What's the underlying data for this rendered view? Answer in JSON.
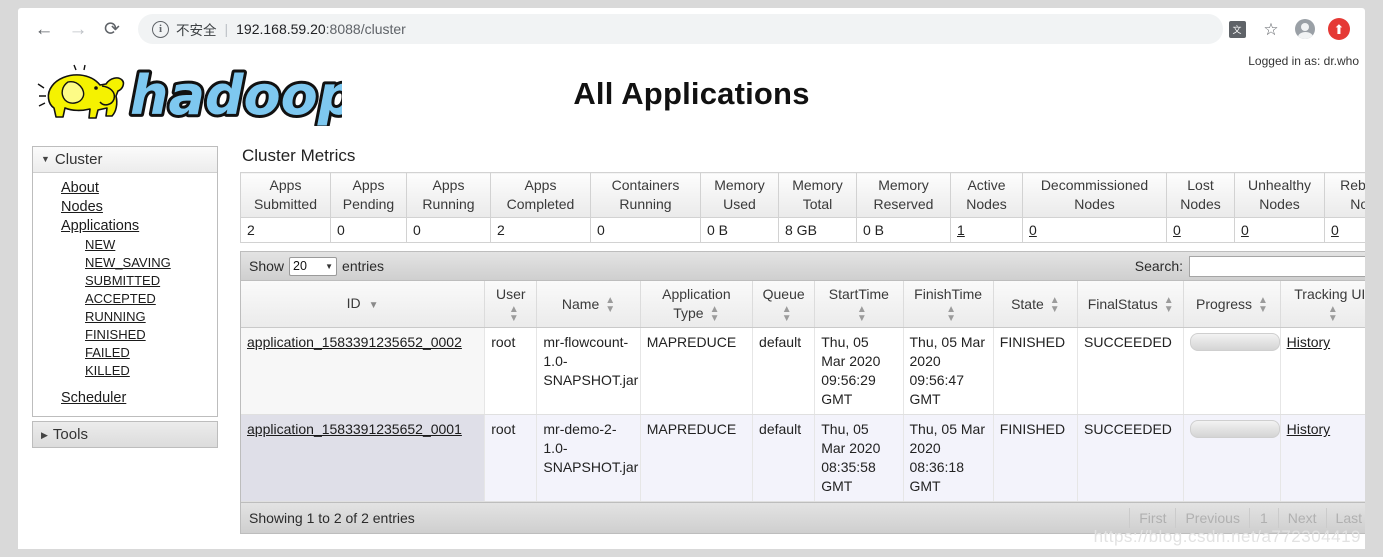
{
  "browser": {
    "back_icon": "arrow-left-icon",
    "forward_icon": "arrow-right-icon",
    "reload_icon": "reload-icon",
    "info_icon": "info-icon",
    "security_label": "不安全",
    "url_host": "192.168.59.20",
    "url_rest": ":8088/cluster",
    "translate_icon": "translate-icon",
    "bookmark_icon": "star-icon",
    "profile_icon": "avatar-icon",
    "extension_icon": "red-arrow-icon"
  },
  "header": {
    "logged_in": "Logged in as: dr.who",
    "title": "All Applications",
    "logo_alt": "hadoop-logo"
  },
  "sidebar": {
    "cluster": {
      "label": "Cluster",
      "links": [
        "About",
        "Nodes",
        "Applications"
      ],
      "states": [
        "NEW",
        "NEW_SAVING",
        "SUBMITTED",
        "ACCEPTED",
        "RUNNING",
        "FINISHED",
        "FAILED",
        "KILLED"
      ],
      "scheduler": "Scheduler"
    },
    "tools": {
      "label": "Tools"
    }
  },
  "metrics": {
    "title": "Cluster Metrics",
    "headers": [
      "Apps\nSubmitted",
      "Apps\nPending",
      "Apps\nRunning",
      "Apps\nCompleted",
      "Containers\nRunning",
      "Memory\nUsed",
      "Memory\nTotal",
      "Memory\nReserved",
      "Active\nNodes",
      "Decommissioned\nNodes",
      "Lost\nNodes",
      "Unhealthy\nNodes",
      "Rebooted\nNodes"
    ],
    "headers_l1": [
      "Apps",
      "Apps",
      "Apps",
      "Apps",
      "Containers",
      "Memory",
      "Memory",
      "Memory",
      "Active",
      "Decommissioned",
      "Lost",
      "Unhealthy",
      "Rebooted"
    ],
    "headers_l2": [
      "Submitted",
      "Pending",
      "Running",
      "Completed",
      "Running",
      "Used",
      "Total",
      "Reserved",
      "Nodes",
      "Nodes",
      "Nodes",
      "Nodes",
      "Nodes"
    ],
    "values": [
      "2",
      "0",
      "0",
      "2",
      "0",
      "0 B",
      "8 GB",
      "0 B",
      "1",
      "0",
      "0",
      "0",
      "0"
    ],
    "link_flags": [
      false,
      false,
      false,
      false,
      false,
      false,
      false,
      false,
      true,
      true,
      true,
      true,
      true
    ]
  },
  "datatable": {
    "show_label": "Show",
    "entries_label": "entries",
    "page_size": "20",
    "search_label": "Search:",
    "search_value": "",
    "search_placeholder": "",
    "columns": [
      {
        "label": "ID",
        "sort": "desc"
      },
      {
        "label": "User",
        "sort": "both"
      },
      {
        "label": "Name",
        "sort": "both"
      },
      {
        "label": "Application Type",
        "sort": "both"
      },
      {
        "label": "Queue",
        "sort": "both"
      },
      {
        "label": "StartTime",
        "sort": "both"
      },
      {
        "label": "FinishTime",
        "sort": "both"
      },
      {
        "label": "State",
        "sort": "both"
      },
      {
        "label": "FinalStatus",
        "sort": "both"
      },
      {
        "label": "Progress",
        "sort": "both"
      },
      {
        "label": "Tracking UI",
        "sort": "both"
      }
    ],
    "rows": [
      {
        "id": "application_1583391235652_0002",
        "user": "root",
        "name": "mr-flowcount-1.0-SNAPSHOT.jar",
        "app_type": "MAPREDUCE",
        "queue": "default",
        "start_time": "Thu, 05 Mar 2020 09:56:29 GMT",
        "finish_time": "Thu, 05 Mar 2020 09:56:47 GMT",
        "state": "FINISHED",
        "final_status": "SUCCEEDED",
        "progress": "0",
        "tracking_ui": "History"
      },
      {
        "id": "application_1583391235652_0001",
        "user": "root",
        "name": "mr-demo-2-1.0-SNAPSHOT.jar",
        "app_type": "MAPREDUCE",
        "queue": "default",
        "start_time": "Thu, 05 Mar 2020 08:35:58 GMT",
        "finish_time": "Thu, 05 Mar 2020 08:36:18 GMT",
        "state": "FINISHED",
        "final_status": "SUCCEEDED",
        "progress": "0",
        "tracking_ui": "History"
      }
    ],
    "showing": "Showing 1 to 2 of 2 entries",
    "pagination": [
      "First",
      "Previous",
      "1",
      "Next",
      "Last"
    ]
  },
  "watermark": "https://blog.csdn.net/a772304419",
  "colors": {
    "accent": "#6fc3ee",
    "logo_yellow": "#f7f300",
    "row_even_bg": "#f3f3fb",
    "chrome_red": "#e53935"
  }
}
